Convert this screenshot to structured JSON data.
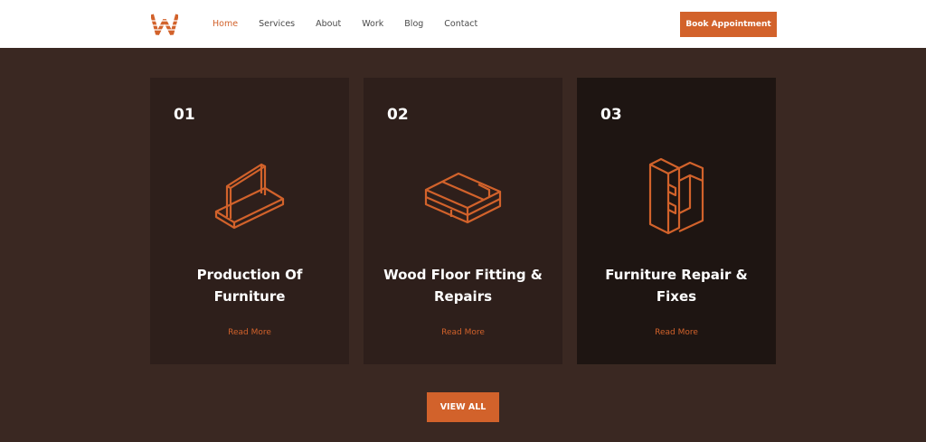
{
  "header": {
    "nav": [
      "Home",
      "Services",
      "About",
      "Work",
      "Blog",
      "Contact"
    ],
    "active_nav": "Home",
    "book_button": "Book Appointment"
  },
  "cards": [
    {
      "number": "01",
      "title_line1": "Production Of",
      "title_line2": "Furniture",
      "link": "Read More",
      "icon": "wood-panel-icon"
    },
    {
      "number": "02",
      "title_line1": "Wood Floor Fitting &",
      "title_line2": "Repairs",
      "link": "Read More",
      "icon": "wood-floor-planks-icon"
    },
    {
      "number": "03",
      "title_line1": "Furniture Repair &",
      "title_line2": "Fixes",
      "link": "Read More",
      "icon": "wood-joint-icon"
    }
  ],
  "view_all": "VIEW ALL",
  "colors": {
    "accent": "#d2622b",
    "background": "#3a2822",
    "card": "#2e1f1b",
    "card_dark": "#1e1512",
    "header": "#ffffff"
  }
}
